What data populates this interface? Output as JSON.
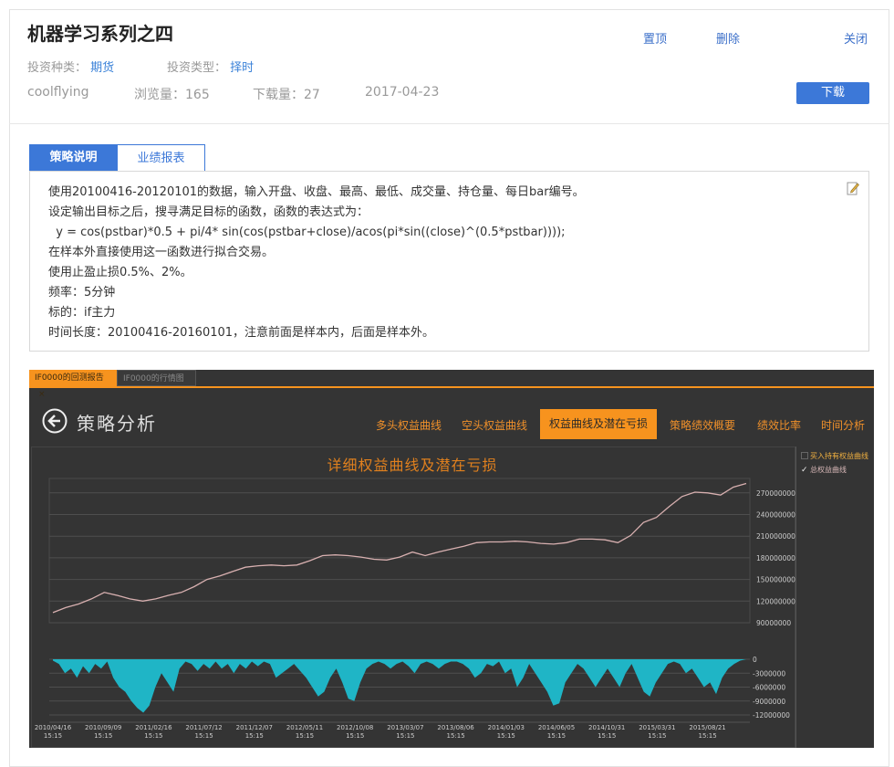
{
  "header": {
    "title": "机器学习系列之四",
    "invest_kind_label": "投资种类：",
    "invest_kind": "期货",
    "invest_type_label": "投资类型：",
    "invest_type": "择时",
    "author": "coolflying",
    "views": "浏览量：165",
    "downloads": "下载量：27",
    "date": "2017-04-23",
    "pin": "置顶",
    "delete": "删除",
    "close": "关闭",
    "download": "下载"
  },
  "tabs": [
    "策略说明",
    "业绩报表"
  ],
  "description": [
    "使用20100416-20120101的数据，输入开盘、收盘、最高、最低、成交量、持仓量、每日bar编号。",
    "设定输出目标之后，搜寻满足目标的函数，函数的表达式为：",
    "  y = cos(pstbar)*0.5 + pi/4* sin(cos(pstbar+close)/acos(pi*sin((close)^(0.5*pstbar))));",
    "在样本外直接使用这一函数进行拟合交易。",
    "使用止盈止损0.5%、2%。",
    "频率：5分钟",
    "标的：if主力",
    "时间长度：20100416-20160101，注意前面是样本内，后面是样本外。"
  ],
  "app": {
    "tab1": "IF0000的回测报告",
    "tab1_close": "×",
    "tab2": "IF0000的行情图",
    "heading": "策略分析",
    "nav": [
      "多头权益曲线",
      "空头权益曲线",
      "权益曲线及潜在亏损",
      "策略绩效概要",
      "绩效比率",
      "时间分析"
    ],
    "active_nav": 2,
    "legend": [
      {
        "label": "买入持有权益曲线",
        "checked": false
      },
      {
        "label": "总权益曲线",
        "checked": true
      }
    ],
    "accent": "#f7931e"
  },
  "chart_data": {
    "type": "line",
    "title": "详细权益曲线及潜在亏损",
    "x_ticks": [
      [
        "2010/04/16",
        "15:15"
      ],
      [
        "2010/09/09",
        "15:15"
      ],
      [
        "2011/02/16",
        "15:15"
      ],
      [
        "2011/07/12",
        "15:15"
      ],
      [
        "2011/12/07",
        "15:15"
      ],
      [
        "2012/05/11",
        "15:15"
      ],
      [
        "2012/10/08",
        "15:15"
      ],
      [
        "2013/03/07",
        "15:15"
      ],
      [
        "2013/08/06",
        "15:15"
      ],
      [
        "2014/01/03",
        "15:15"
      ],
      [
        "2014/06/05",
        "15:15"
      ],
      [
        "2014/10/31",
        "15:15"
      ],
      [
        "2015/03/31",
        "15:15"
      ],
      [
        "2015/08/21",
        "15:15"
      ]
    ],
    "equity": {
      "y_ticks": [
        "270000000",
        "240000000",
        "210000000",
        "180000000",
        "150000000",
        "120000000",
        "90000000"
      ],
      "ylim": [
        90000000,
        290000000
      ],
      "values_millions": [
        104,
        111,
        116,
        123,
        132,
        128,
        123,
        120,
        123,
        128,
        132,
        140,
        150,
        155,
        161,
        167,
        169,
        170,
        169,
        170,
        176,
        183,
        184,
        183,
        181,
        178,
        177,
        181,
        188,
        183,
        188,
        192,
        196,
        201,
        202,
        202,
        203,
        202,
        200,
        199,
        201,
        206,
        206,
        205,
        201,
        211,
        229,
        236,
        251,
        265,
        271,
        270,
        267,
        278,
        283
      ]
    },
    "drawdown": {
      "y_ticks": [
        "0",
        "-3000000",
        "-6000000",
        "-9000000",
        "-12000000"
      ],
      "ylim": [
        -12000000,
        0
      ],
      "values_millions": [
        -0.3,
        -1,
        -3,
        -2,
        -4,
        -1.5,
        -3,
        -1,
        -2,
        -0.5,
        -4,
        -6,
        -7,
        -9,
        -10.5,
        -11.5,
        -10,
        -6,
        -3,
        -5,
        -7,
        -2,
        -0.5,
        -1,
        -2.5,
        -1,
        -2,
        -0.5,
        -2,
        -1,
        -3,
        -1,
        -2,
        -0.5,
        -1.5,
        -0.5,
        -1,
        -4,
        -3,
        -2,
        -1,
        -2.5,
        -4,
        -6,
        -8,
        -7,
        -4,
        -2,
        -5,
        -8.5,
        -9,
        -5,
        -2,
        -1,
        -0.5,
        -1,
        -2,
        -1,
        -0.5,
        -1.5,
        -3,
        -1,
        -0.5,
        -1,
        -2,
        -1,
        -0.5,
        -0.5,
        -1,
        -2,
        -4,
        -3,
        -1,
        -1.5,
        -0.5,
        -3,
        -2,
        -6,
        -4,
        -1,
        -3,
        -5,
        -7,
        -10,
        -9.5,
        -5,
        -3,
        -1,
        -2,
        -4,
        -6,
        -4,
        -2,
        -4,
        -6,
        -3,
        -1,
        -4,
        -7,
        -8,
        -5,
        -3,
        -1,
        -0.5,
        -1,
        -3,
        -2,
        -4,
        -6,
        -5,
        -7.5,
        -4,
        -2,
        -1,
        -0.3,
        0
      ]
    }
  }
}
